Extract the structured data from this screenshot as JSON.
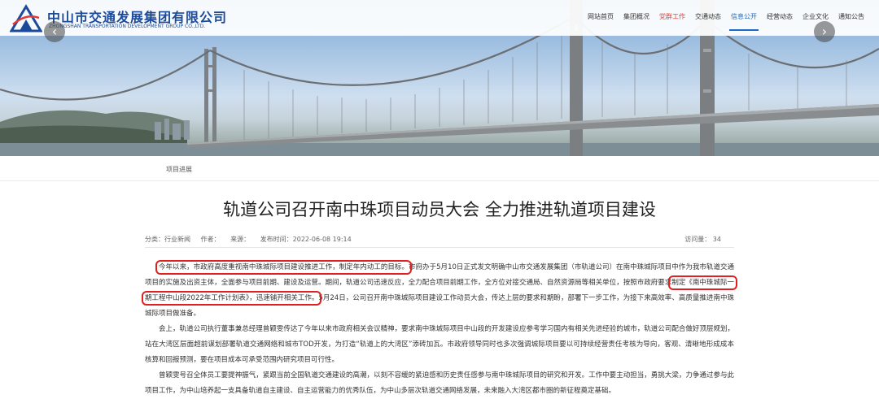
{
  "header": {
    "company_cn": "中山市交通发展集团有限公司",
    "company_en": "ZHONGSHAN TRANSPORTATION DEVELOPMENT GROUP CO.,LTD.",
    "nav": [
      {
        "label": "网站首页",
        "state": "normal"
      },
      {
        "label": "集团概况",
        "state": "normal"
      },
      {
        "label": "党群工作",
        "state": "hot"
      },
      {
        "label": "交通动态",
        "state": "normal"
      },
      {
        "label": "信息公开",
        "state": "active"
      },
      {
        "label": "经营动态",
        "state": "normal"
      },
      {
        "label": "企业文化",
        "state": "normal"
      },
      {
        "label": "通知公告",
        "state": "normal"
      }
    ],
    "prev_glyph": "‹",
    "next_glyph": "›"
  },
  "breadcrumb": "项目进展",
  "article": {
    "title": "轨道公司召开南中珠项目动员大会 全力推进轨道项目建设",
    "meta": {
      "category": "分类：行业新闻",
      "author": "作者：",
      "source": "来源：",
      "published": "发布时间：2022-06-08 19:14",
      "visits": "访问量：  34"
    },
    "p1": {
      "highlight1": "今年以来，市政府高度重视南中珠城际项目建设推进工作，制定年内动工的目标。",
      "part2": "市府办于5月10日正式发文明确中山市交通发展集团（市轨道公司）在南中珠城际项目中作为我市轨道交通项目的实施及出资主体，全面参与项目前期、建设及运营。期间，轨道公司迅速反应，全力配合项目前期工作，全方位对接交通局、自然资源局等相关单位，按照市政府要求",
      "highlight2": "制定《南中珠城际一期工程中山段2022年工作计划表》，迅速铺开相关工作。",
      "part3": "5月24日，公司召开南中珠城际项目建设工作动员大会，传达上层的要求和期盼，部署下一步工作，为接下来高效率、高质量推进南中珠城际项目做准备。"
    },
    "p2": "会上，轨道公司执行董事兼总经理曾颖雯传达了今年以来市政府相关会议精神，要求南中珠城际项目中山段的开发建设应参考学习国内有相关先进经验的城市，轨道公司配合做好顶层规划，站在大湾区层面超前谋划部署轨道交通网络和城市TOD开发，为打造“轨道上的大湾区”添砖加瓦。市政府领导同时也多次强调城际项目要以可持续经营责任考核为导向，客观、清晰地形成成本核算和回报预测，要在项目成本可承受范围内研究项目可行性。",
    "p3": "曾颖雯号召全体员工要提神振气，紧跟当前全国轨道交通建设的高潮，以刻不容缓的紧迫感和历史责任感参与南中珠城际项目的研究和开发。工作中要主动担当，勇挑大梁，力争通过参与此项目工作，为中山培养起一支具备轨道自主建设、自主运营能力的优秀队伍，为中山多层次轨道交通网络发展，未来融入大湾区都市圈的新征程奠定基础。"
  },
  "colors": {
    "brand_blue": "#1b4a9b",
    "active_blue": "#1b6bc2",
    "hot_red": "#e53935",
    "highlight_border": "#e02020"
  }
}
